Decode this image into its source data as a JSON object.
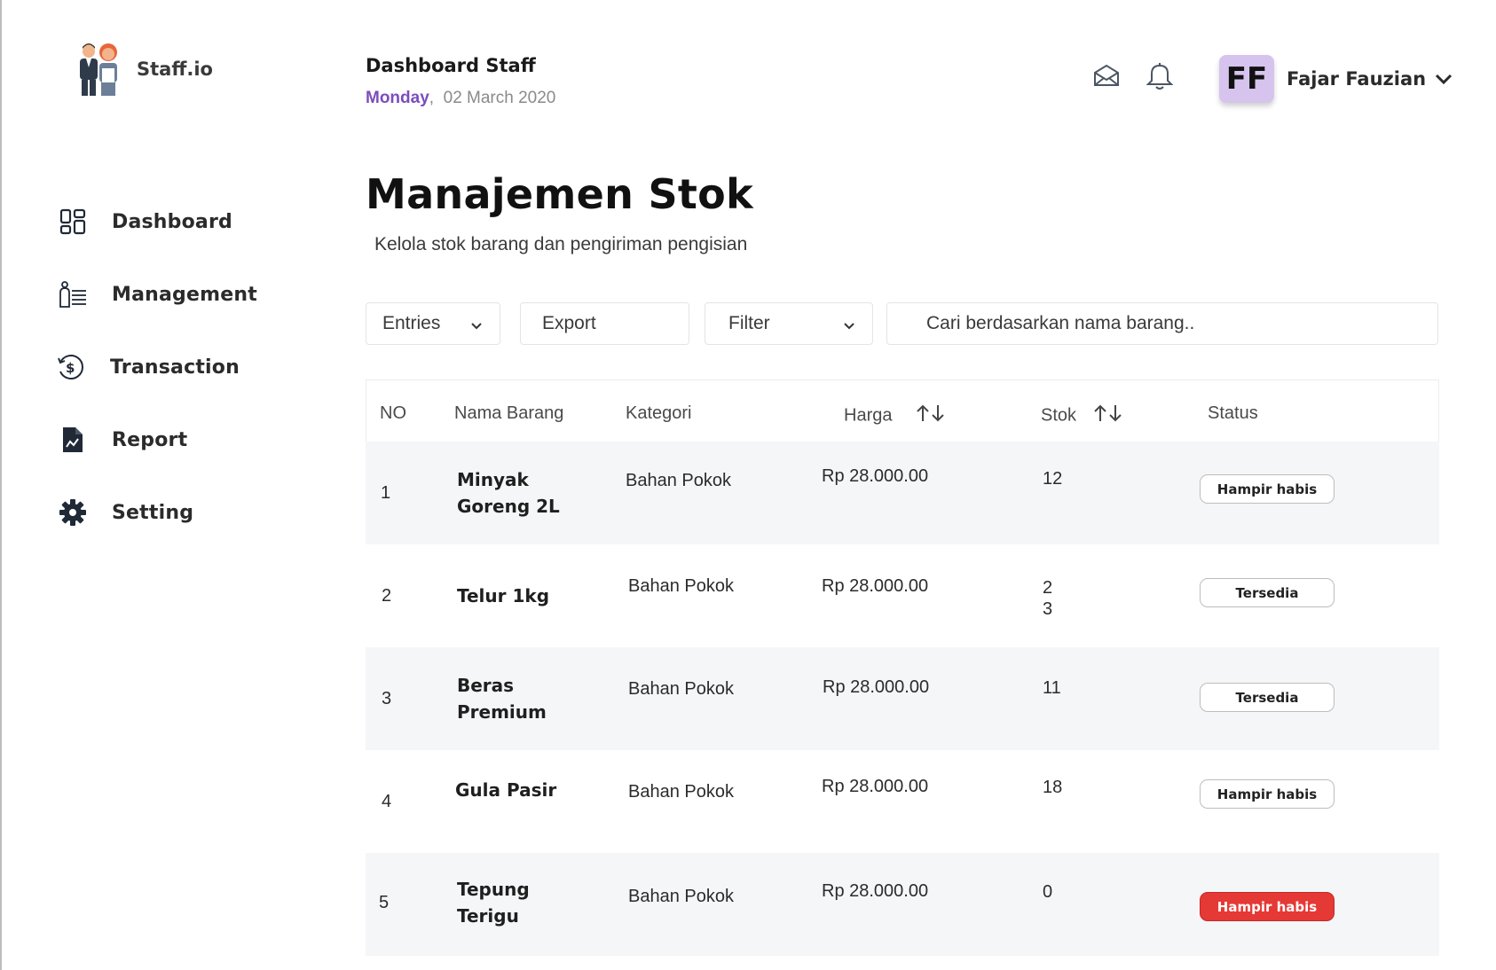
{
  "brand": {
    "name": "Staff.io"
  },
  "sidebar": {
    "items": [
      {
        "label": "Dashboard",
        "icon": "grid-icon"
      },
      {
        "label": "Management",
        "icon": "list-user-icon"
      },
      {
        "label": "Transaction",
        "icon": "dollar-refresh-icon"
      },
      {
        "label": "Report",
        "icon": "report-file-icon"
      },
      {
        "label": "Setting",
        "icon": "gear-icon"
      }
    ]
  },
  "header": {
    "title": "Dashboard Staff",
    "day": "Monday",
    "date": "02 March 2020",
    "user_initials": "FF",
    "user_name": "Fajar Fauzian"
  },
  "page": {
    "title": "Manajemen Stok",
    "subtitle": "Kelola stok barang dan pengiriman pengisian"
  },
  "toolbar": {
    "entries_label": "Entries",
    "export_label": "Export",
    "filter_label": "Filter",
    "search_placeholder": "Cari berdasarkan nama barang.."
  },
  "table": {
    "columns": {
      "no": "NO",
      "nama": "Nama Barang",
      "kategori": "Kategori",
      "harga": "Harga",
      "stok": "Stok",
      "status": "Status"
    },
    "rows": [
      {
        "no": "1",
        "nama": "Minyak Goreng 2L",
        "kategori": "Bahan Pokok",
        "harga": "Rp 28.000.00",
        "stok": "12",
        "status": "Hampir habis",
        "status_type": "outline"
      },
      {
        "no": "2",
        "nama": "Telur 1kg",
        "kategori": "Bahan Pokok",
        "harga": "Rp 28.000.00",
        "stok": "23",
        "status": "Tersedia",
        "status_type": "outline"
      },
      {
        "no": "3",
        "nama": "Beras Premium",
        "kategori": "Bahan Pokok",
        "harga": "Rp 28.000.00",
        "stok": "11",
        "status": "Tersedia",
        "status_type": "outline"
      },
      {
        "no": "4",
        "nama": "Gula Pasir",
        "kategori": "Bahan Pokok",
        "harga": "Rp 28.000.00",
        "stok": "18",
        "status": "Hampir habis",
        "status_type": "outline"
      },
      {
        "no": "5",
        "nama": "Tepung Terigu",
        "kategori": "Bahan Pokok",
        "harga": "Rp 28.000.00",
        "stok": "0",
        "status": "Hampir habis",
        "status_type": "danger"
      }
    ]
  },
  "colors": {
    "accent_purple": "#7c4dbd",
    "avatar_bg": "#d6c4ee",
    "danger": "#e53935",
    "row_alt": "#f5f6f8"
  }
}
